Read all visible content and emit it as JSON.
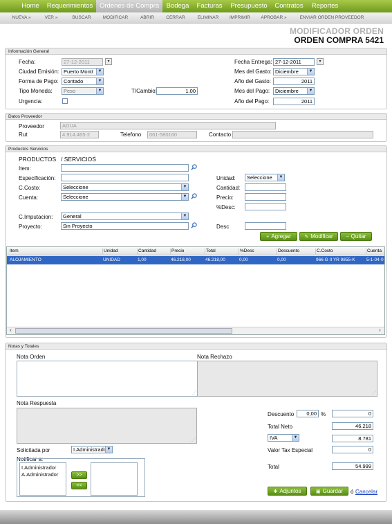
{
  "nav": {
    "items": [
      "Home",
      "Requerimientos",
      "Ordenes de Compra",
      "Bodega",
      "Facturas",
      "Presupuesto",
      "Contratos",
      "Reportes"
    ],
    "active": 2
  },
  "subnav": [
    "NUEVA »",
    "VER »",
    "BUSCAR",
    "MODIFICAR",
    "ABRIR",
    "CERRAR",
    "ELIMINAR",
    "IMPRIMIR",
    "APROBAR »",
    "ENVIAR ORDEN PROVEEDOR"
  ],
  "header": {
    "title": "MODIFICADOR ORDEN",
    "subtitle": "ORDEN COMPRA 5421"
  },
  "general": {
    "heading": "Información General",
    "fecha_label": "Fecha:",
    "fecha": "27-12-2011",
    "ciudad_label": "Ciudad Emisión:",
    "ciudad": "Puerto Montt",
    "forma_label": "Forma de Pago:",
    "forma": "Contado",
    "moneda_label": "Tipo Moneda:",
    "moneda": "Peso",
    "tcambio_label": "T/Cambio:",
    "tcambio": "1.00",
    "urgencia_label": "Urgencia:",
    "fentrega_label": "Fecha Entrega:",
    "fentrega": "27-12-2011",
    "mesgasto_label": "Mes del Gasto:",
    "mesgasto": "Diciembre",
    "aniogasto_label": "Año del Gasto:",
    "aniogasto": "2011",
    "mespago_label": "Mes del Pago:",
    "mespago": "Diciembre",
    "aniopago_label": "Año del Pago:",
    "aniopago": "2011"
  },
  "proveedor": {
    "heading": "Datos Proveedor",
    "prov_label": "Proveedor",
    "prov": "ADUA",
    "rut_label": "Rut",
    "rut": "4.914.465-2",
    "tel_label": "Telefono",
    "tel": "061-580160",
    "contacto_label": "Contacto",
    "contacto": ""
  },
  "productos": {
    "heading": "Productos Servicios",
    "tab1": "PRODUCTOS",
    "tab2": "/ SERVICIOS",
    "item_label": "Item:",
    "esp_label": "Especificación:",
    "ccosto_label": "C.Costo:",
    "ccosto": "Seleccione",
    "cuenta_label": "Cuenta:",
    "cuenta": "Seleccione",
    "cimp_label": "C.Imputacion:",
    "cimp": "General",
    "proyecto_label": "Proyecto:",
    "proyecto": "Sin Proyecto",
    "unidad_label": "Unidad:",
    "unidad": "Seleccione",
    "cantidad_label": "Cantidad:",
    "precio_label": "Precio:",
    "pdesc_label": "%Desc:",
    "desc_label": "Desc",
    "btn_add": "Agregar",
    "btn_mod": "Modificar",
    "btn_del": "Quitar"
  },
  "table": {
    "columns": [
      "Item",
      "Unidad",
      "Cantidad",
      "Precio",
      "Total",
      "%Desc",
      "Descuento",
      "C.Costo",
      "Cuenta"
    ],
    "rows": [
      [
        "ALOJAMIENTO",
        "UNIDAD",
        "1,00",
        "46.218,00",
        "46.218,00",
        "0,00",
        "0,00",
        "966 G II YR 9855-K",
        "5-1-04-0"
      ]
    ]
  },
  "notas": {
    "heading": "Notas y Totales",
    "orden_label": "Nota Orden",
    "rechazo_label": "Nota Rechazo",
    "respuesta_label": "Nota Respuesta",
    "solicitada_label": "Solicitada por",
    "solicitada": "I.Administrador",
    "notificar_label": "Notificar a:",
    "notificar_items": [
      "I.Administrador",
      "A.Administrador"
    ],
    "move_right": ">>",
    "move_left": "<<"
  },
  "totales": {
    "descuento_label": "Descuento",
    "descuento_pct": "0,00",
    "pct": "%",
    "descuento": "0",
    "neto_label": "Total Neto",
    "neto": "46.218",
    "iva_label": "IVA",
    "iva": "8.781",
    "tax_label": "Valor Tax Especial",
    "tax": "0",
    "total_label": "Total",
    "total": "54.999"
  },
  "actions": {
    "adjuntos": "Adjuntos",
    "guardar": "Guardar",
    "o": "ó",
    "cancelar": "Cancelar"
  }
}
